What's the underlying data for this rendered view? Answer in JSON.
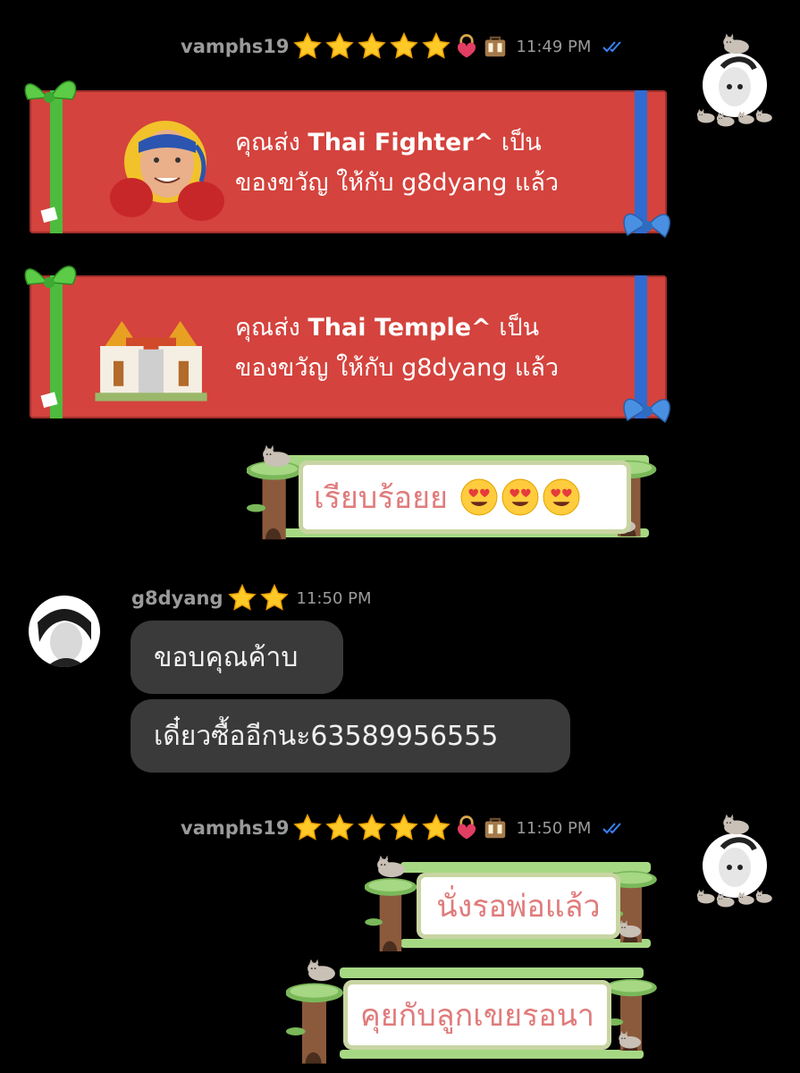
{
  "messages": [
    {
      "user": "vamphs19",
      "time": "11:49 PM",
      "gifts": [
        {
          "line1_pre": "คุณส่ง ",
          "name": "Thai Fighter^",
          "line1_post": " เป็น",
          "line2": "ของขวัญ ให้กับ g8dyang แล้ว",
          "icon": "boxer-icon"
        },
        {
          "line1_pre": "คุณส่ง ",
          "name": "Thai Temple^",
          "line1_post": " เป็น",
          "line2": "ของขวัญ ให้กับ g8dyang แล้ว",
          "icon": "temple-icon"
        }
      ],
      "sticker": "เรียบร้อยย"
    },
    {
      "user": "g8dyang",
      "time": "11:50 PM",
      "bubbles": [
        "ขอบคุณค้าบ",
        "เดี๋ยวซื้ออีกนะ63589956555"
      ]
    },
    {
      "user": "vamphs19",
      "time": "11:50 PM",
      "stickers": [
        "นั่งรอพ่อแล้ว",
        "คุยกับลูกเขยรอนา"
      ]
    }
  ],
  "colors": {
    "background": "#000000",
    "gift_red": "#d4433d",
    "bubble": "#3a3a3a",
    "sticker_text": "#e07b7b",
    "read_ticks": "#3b82f6"
  }
}
